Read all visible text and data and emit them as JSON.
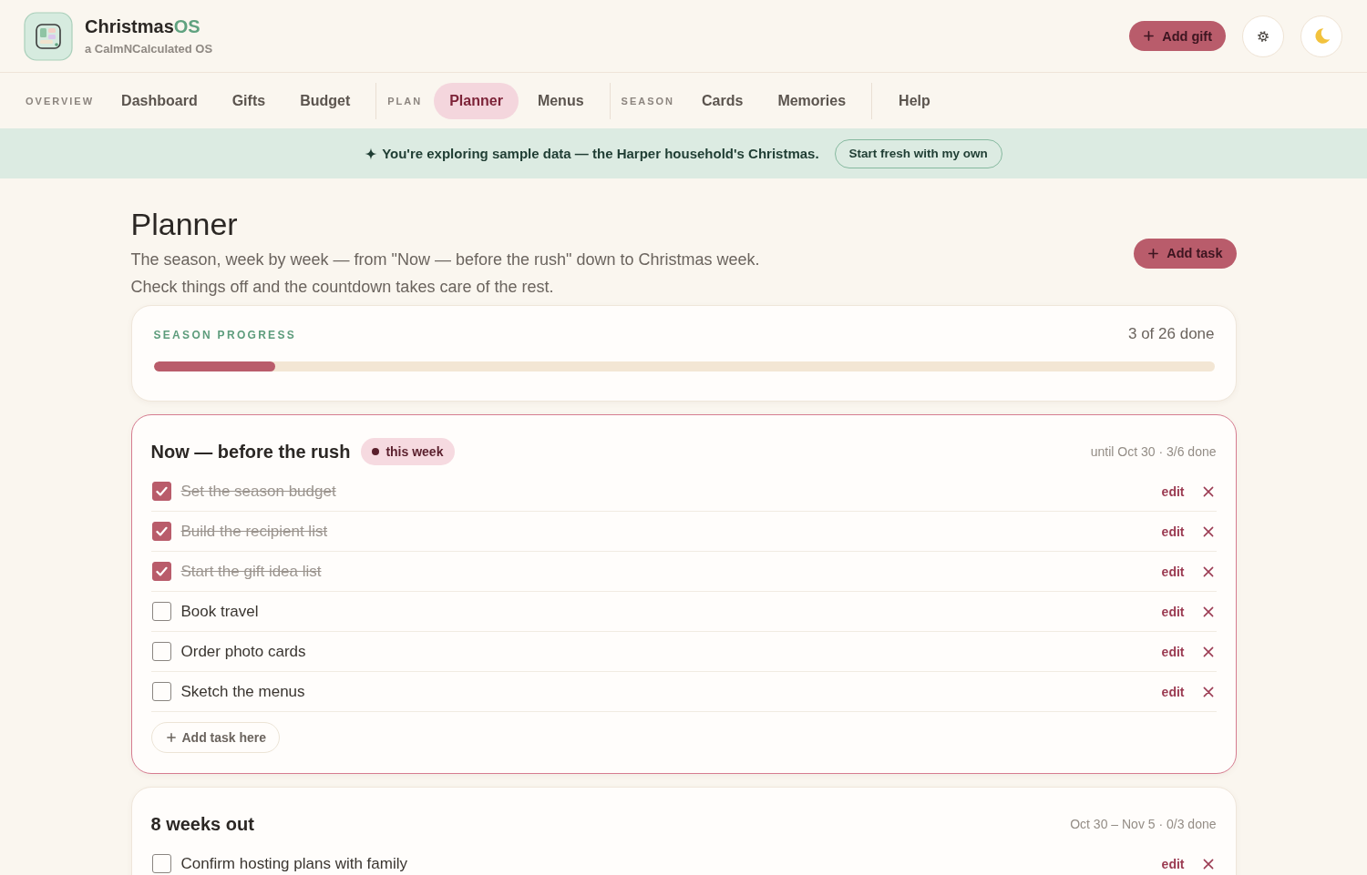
{
  "app": {
    "name_main": "Christmas",
    "name_accent": "OS",
    "subtitle": "a CalmNCalculated OS"
  },
  "header_actions": {
    "add_gift": "Add gift"
  },
  "nav": {
    "groups": [
      {
        "label": "OVERVIEW",
        "items": [
          {
            "label": "Dashboard",
            "selected": false
          },
          {
            "label": "Gifts",
            "selected": false
          },
          {
            "label": "Budget",
            "selected": false
          }
        ]
      },
      {
        "label": "PLAN",
        "items": [
          {
            "label": "Planner",
            "selected": true
          },
          {
            "label": "Menus",
            "selected": false
          }
        ]
      },
      {
        "label": "SEASON",
        "items": [
          {
            "label": "Cards",
            "selected": false
          },
          {
            "label": "Memories",
            "selected": false
          }
        ]
      },
      {
        "items": [
          {
            "label": "Help",
            "selected": false
          }
        ]
      }
    ]
  },
  "banner": {
    "text": "You're exploring sample data — the Harper household's Christmas.",
    "button": "Start fresh with my own"
  },
  "page": {
    "title": "Planner",
    "description": [
      "The season, week by week — from \"Now — before the rush\" down to Christmas week.",
      "Check things off and the countdown takes care of the rest."
    ],
    "add_button": "Add task"
  },
  "progress": {
    "label": "SEASON PROGRESS",
    "summary": "3 of 26 done",
    "level": 0.115
  },
  "weeks": [
    {
      "title": "Now — before the rush",
      "current": true,
      "badge": "this week",
      "meta": "until Oct 30 · 3/6 done",
      "tasks": [
        {
          "title": "Set the season budget",
          "checked": true,
          "edit": "edit"
        },
        {
          "title": "Build the recipient list",
          "checked": true,
          "edit": "edit"
        },
        {
          "title": "Start the gift idea list",
          "checked": true,
          "edit": "edit"
        },
        {
          "title": "Book travel",
          "checked": false,
          "edit": "edit"
        },
        {
          "title": "Order photo cards",
          "checked": false,
          "edit": "edit"
        },
        {
          "title": "Sketch the menus",
          "checked": false,
          "edit": "edit"
        }
      ],
      "add_button": "Add task here"
    },
    {
      "title": "8 weeks out",
      "current": false,
      "meta": "Oct 30 – Nov 5 · 0/3 done",
      "tasks": [
        {
          "title": "Confirm hosting plans with family",
          "checked": false,
          "edit": "edit"
        }
      ]
    }
  ]
}
